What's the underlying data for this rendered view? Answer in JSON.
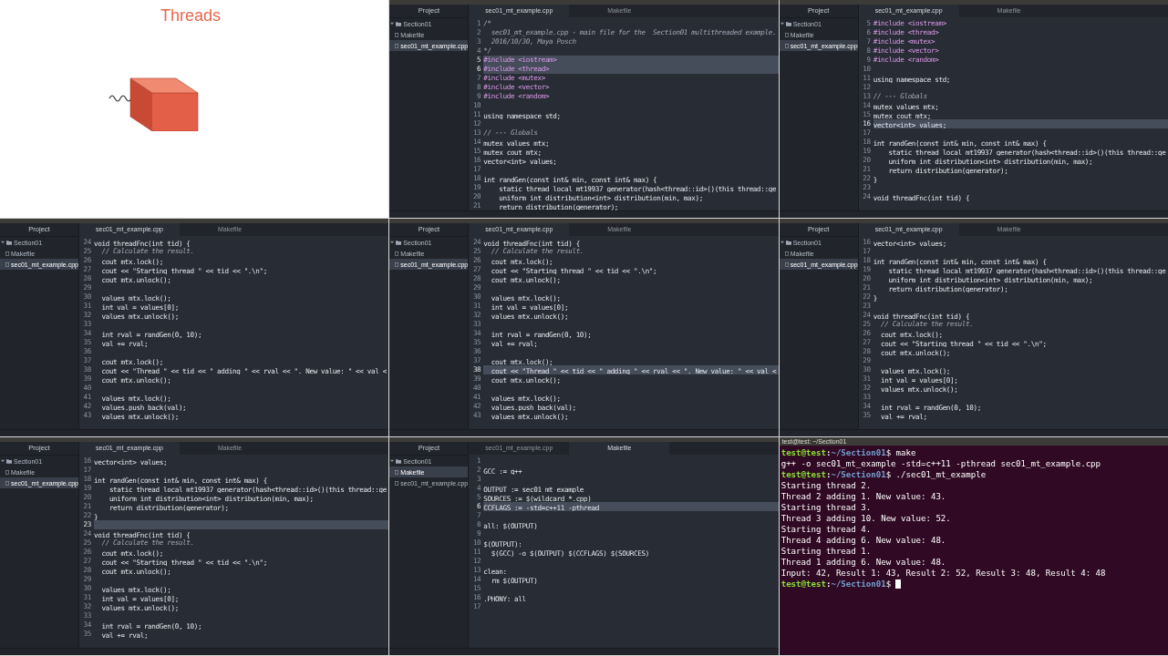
{
  "tiles": [
    {
      "kind": "slide",
      "title": "Threads"
    },
    {
      "kind": "editor",
      "project_title": "Project",
      "tree": [
        {
          "label": "Section01",
          "expanded": true,
          "selected": false,
          "children": [
            {
              "label": "Makefile",
              "selected": false
            },
            {
              "label": "sec01_mt_example.cpp",
              "selected": true
            }
          ]
        }
      ],
      "tabs": [
        {
          "label": "sec01_mt_example.cpp",
          "selected": true
        },
        {
          "label": "Makefile",
          "selected": false
        }
      ],
      "lines": [
        {
          "n": "1",
          "code": "/*",
          "kind": "comment",
          "highlighted": false
        },
        {
          "n": "2",
          "code": "  sec01_mt_example.cpp - main file for the  Section01 multithreaded example.",
          "kind": "comment",
          "highlighted": false
        },
        {
          "n": "3",
          "code": "  2016/10/30, Maya Posch",
          "kind": "comment",
          "highlighted": false
        },
        {
          "n": "4",
          "code": "*/",
          "kind": "comment",
          "highlighted": false
        },
        {
          "n": "5",
          "code": "#include <iostream>",
          "kind": "directive",
          "highlighted": true
        },
        {
          "n": "6",
          "code": "#include <thread>",
          "kind": "directive",
          "highlighted": true
        },
        {
          "n": "7",
          "code": "#include <mutex>",
          "kind": "directive",
          "highlighted": false
        },
        {
          "n": "8",
          "code": "#include <vector>",
          "kind": "directive",
          "highlighted": false
        },
        {
          "n": "9",
          "code": "#include <random>",
          "kind": "directive",
          "highlighted": false
        },
        {
          "n": "10",
          "kind": "code",
          "highlighted": false
        },
        {
          "n": "11",
          "code": "using namespace std;",
          "kind": "code",
          "highlighted": false
        },
        {
          "n": "12",
          "kind": "code",
          "highlighted": false
        },
        {
          "n": "13",
          "code": "// --- Globals",
          "kind": "comment",
          "highlighted": false
        },
        {
          "n": "14",
          "code": "mutex values_mtx;",
          "kind": "code",
          "highlighted": false
        },
        {
          "n": "15",
          "code": "mutex cout_mtx;",
          "kind": "code",
          "highlighted": false
        },
        {
          "n": "16",
          "code": "vector<int> values;",
          "kind": "code",
          "highlighted": false
        },
        {
          "n": "17",
          "kind": "code",
          "highlighted": false
        },
        {
          "n": "18",
          "code": "int randGen(const int& min, const int& max) {",
          "kind": "code",
          "highlighted": false
        },
        {
          "n": "19",
          "code": "    static thread_local mt19937 generator(hash<thread::id>()(this_thread::ge",
          "kind": "code",
          "highlighted": false
        },
        {
          "n": "20",
          "code": "    uniform_int_distribution<int> distribution(min, max);",
          "kind": "code",
          "highlighted": false
        },
        {
          "n": "21",
          "code": "    return distribution(generator);",
          "kind": "code",
          "highlighted": false
        }
      ]
    },
    {
      "kind": "editor",
      "project_title": "Project",
      "tree": [
        {
          "label": "Section01",
          "expanded": true,
          "selected": false,
          "children": [
            {
              "label": "Makefile",
              "selected": false
            },
            {
              "label": "sec01_mt_example.cpp",
              "selected": true
            }
          ]
        }
      ],
      "tabs": [
        {
          "label": "sec01_mt_example.cpp",
          "selected": true
        },
        {
          "label": "Makefile",
          "selected": false
        }
      ],
      "lines": [
        {
          "n": "5",
          "code": "#include <iostream>",
          "kind": "directive",
          "highlighted": false
        },
        {
          "n": "6",
          "code": "#include <thread>",
          "kind": "directive",
          "highlighted": false
        },
        {
          "n": "7",
          "code": "#include <mutex>",
          "kind": "directive",
          "highlighted": false
        },
        {
          "n": "8",
          "code": "#include <vector>",
          "kind": "directive",
          "highlighted": false
        },
        {
          "n": "9",
          "code": "#include <random>",
          "kind": "directive",
          "highlighted": false
        },
        {
          "n": "10",
          "kind": "code",
          "highlighted": false
        },
        {
          "n": "11",
          "code": "using namespace std;",
          "kind": "code",
          "highlighted": false
        },
        {
          "n": "12",
          "kind": "code",
          "highlighted": false
        },
        {
          "n": "13",
          "code": "// --- Globals",
          "kind": "comment",
          "highlighted": false
        },
        {
          "n": "14",
          "code": "mutex values_mtx;",
          "kind": "code",
          "highlighted": false
        },
        {
          "n": "15",
          "code": "mutex cout_mtx;",
          "kind": "code",
          "highlighted": false
        },
        {
          "n": "16",
          "code": "vector<int> values;",
          "kind": "code",
          "highlighted": true
        },
        {
          "n": "17",
          "kind": "code",
          "highlighted": false
        },
        {
          "n": "18",
          "code": "int randGen(const int& min, const int& max) {",
          "kind": "code",
          "highlighted": false
        },
        {
          "n": "19",
          "code": "    static thread_local mt19937 generator(hash<thread::id>()(this_thread::ge",
          "kind": "code",
          "highlighted": false
        },
        {
          "n": "20",
          "code": "    uniform_int_distribution<int> distribution(min, max);",
          "kind": "code",
          "highlighted": false
        },
        {
          "n": "21",
          "code": "    return distribution(generator);",
          "kind": "code",
          "highlighted": false
        },
        {
          "n": "22",
          "code": "}",
          "kind": "code",
          "highlighted": false
        },
        {
          "n": "23",
          "kind": "code",
          "highlighted": false
        },
        {
          "n": "24",
          "code": "void threadFnc(int tid) {",
          "kind": "code",
          "highlighted": false
        }
      ]
    },
    {
      "kind": "editor",
      "project_title": "Project",
      "tree": [
        {
          "label": "Section01",
          "expanded": true,
          "selected": false,
          "children": [
            {
              "label": "Makefile",
              "selected": false
            },
            {
              "label": "sec01_mt_example.cpp",
              "selected": true
            }
          ]
        }
      ],
      "tabs": [
        {
          "label": "sec01_mt_example.cpp",
          "selected": true
        },
        {
          "label": "Makefile",
          "selected": false
        }
      ],
      "lines": [
        {
          "n": "24",
          "code": "void threadFnc(int tid) {",
          "kind": "code",
          "highlighted": false
        },
        {
          "n": "25",
          "code": "  // Calculate the result.",
          "kind": "comment",
          "highlighted": false
        },
        {
          "n": "26",
          "code": "  cout_mtx.lock();",
          "kind": "code",
          "highlighted": false
        },
        {
          "n": "27",
          "code": "  cout << \"Starting thread \" << tid << \".\\n\";",
          "kind": "code",
          "highlighted": false
        },
        {
          "n": "28",
          "code": "  cout_mtx.unlock();",
          "kind": "code",
          "highlighted": false
        },
        {
          "n": "29",
          "kind": "code",
          "highlighted": false
        },
        {
          "n": "30",
          "code": "  values_mtx.lock();",
          "kind": "code",
          "highlighted": false
        },
        {
          "n": "31",
          "code": "  int val = values[0];",
          "kind": "code",
          "highlighted": false
        },
        {
          "n": "32",
          "code": "  values_mtx.unlock();",
          "kind": "code",
          "highlighted": false
        },
        {
          "n": "33",
          "kind": "code",
          "highlighted": false
        },
        {
          "n": "34",
          "code": "  int rval = randGen(0, 10);",
          "kind": "code",
          "highlighted": false
        },
        {
          "n": "35",
          "code": "  val += rval;",
          "kind": "code",
          "highlighted": false
        },
        {
          "n": "36",
          "kind": "code",
          "highlighted": false
        },
        {
          "n": "37",
          "code": "  cout_mtx.lock();",
          "kind": "code",
          "highlighted": false
        },
        {
          "n": "38",
          "code": "  cout << \"Thread \" << tid << \" adding \" << rval << \". New value: \" << val <",
          "kind": "code",
          "highlighted": false
        },
        {
          "n": "39",
          "code": "  cout_mtx.unlock();",
          "kind": "code",
          "highlighted": false
        },
        {
          "n": "40",
          "kind": "code",
          "highlighted": false
        },
        {
          "n": "41",
          "code": "  values_mtx.lock();",
          "kind": "code",
          "highlighted": false
        },
        {
          "n": "42",
          "code": "  values.push_back(val);",
          "kind": "code",
          "highlighted": false
        },
        {
          "n": "43",
          "code": "  values_mtx.unlock();",
          "kind": "code",
          "highlighted": false
        }
      ]
    },
    {
      "kind": "editor",
      "project_title": "Project",
      "tree": [
        {
          "label": "Section01",
          "expanded": true,
          "selected": false,
          "children": [
            {
              "label": "Makefile",
              "selected": false
            },
            {
              "label": "sec01_mt_example.cpp",
              "selected": true
            }
          ]
        }
      ],
      "tabs": [
        {
          "label": "sec01_mt_example.cpp",
          "selected": true
        },
        {
          "label": "Makefile",
          "selected": false
        }
      ],
      "lines": [
        {
          "n": "24",
          "code": "void threadFnc(int tid) {",
          "kind": "code",
          "highlighted": false
        },
        {
          "n": "25",
          "code": "  // Calculate the result.",
          "kind": "comment",
          "highlighted": false
        },
        {
          "n": "26",
          "code": "  cout_mtx.lock();",
          "kind": "code",
          "highlighted": false
        },
        {
          "n": "27",
          "code": "  cout << \"Starting thread \" << tid << \".\\n\";",
          "kind": "code",
          "highlighted": false
        },
        {
          "n": "28",
          "code": "  cout_mtx.unlock();",
          "kind": "code",
          "highlighted": false
        },
        {
          "n": "29",
          "kind": "code",
          "highlighted": false
        },
        {
          "n": "30",
          "code": "  values_mtx.lock();",
          "kind": "code",
          "highlighted": false
        },
        {
          "n": "31",
          "code": "  int val = values[0];",
          "kind": "code",
          "highlighted": false
        },
        {
          "n": "32",
          "code": "  values_mtx.unlock();",
          "kind": "code",
          "highlighted": false
        },
        {
          "n": "33",
          "kind": "code",
          "highlighted": false
        },
        {
          "n": "34",
          "code": "  int rval = randGen(0, 10);",
          "kind": "code",
          "highlighted": false
        },
        {
          "n": "35",
          "code": "  val += rval;",
          "kind": "code",
          "highlighted": false
        },
        {
          "n": "36",
          "kind": "code",
          "highlighted": false
        },
        {
          "n": "37",
          "code": "  cout_mtx.lock();",
          "kind": "code",
          "highlighted": false
        },
        {
          "n": "38",
          "code": "  cout << \"Thread \" << tid << \" adding \" << rval << \". New value: \" << val <",
          "kind": "code",
          "highlighted": true
        },
        {
          "n": "39",
          "code": "  cout_mtx.unlock();",
          "kind": "code",
          "highlighted": false
        },
        {
          "n": "40",
          "kind": "code",
          "highlighted": false
        },
        {
          "n": "41",
          "code": "  values_mtx.lock();",
          "kind": "code",
          "highlighted": false
        },
        {
          "n": "42",
          "code": "  values.push_back(val);",
          "kind": "code",
          "highlighted": false
        },
        {
          "n": "43",
          "code": "  values_mtx.unlock();",
          "kind": "code",
          "highlighted": false
        }
      ]
    },
    {
      "kind": "editor",
      "project_title": "Project",
      "tree": [
        {
          "label": "Section01",
          "expanded": true,
          "selected": false,
          "children": [
            {
              "label": "Makefile",
              "selected": false
            },
            {
              "label": "sec01_mt_example.cpp",
              "selected": true
            }
          ]
        }
      ],
      "tabs": [
        {
          "label": "sec01_mt_example.cpp",
          "selected": true
        },
        {
          "label": "Makefile",
          "selected": false
        }
      ],
      "lines": [
        {
          "n": "16",
          "code": "vector<int> values;",
          "kind": "code",
          "highlighted": false
        },
        {
          "n": "17",
          "kind": "code",
          "highlighted": false
        },
        {
          "n": "18",
          "code": "int randGen(const int& min, const int& max) {",
          "kind": "code",
          "highlighted": false
        },
        {
          "n": "19",
          "code": "    static thread_local mt19937 generator(hash<thread::id>()(this_thread::ge",
          "kind": "code",
          "highlighted": false
        },
        {
          "n": "20",
          "code": "    uniform_int_distribution<int> distribution(min, max);",
          "kind": "code",
          "highlighted": false
        },
        {
          "n": "21",
          "code": "    return distribution(generator);",
          "kind": "code",
          "highlighted": false
        },
        {
          "n": "22",
          "code": "}",
          "kind": "code",
          "highlighted": false
        },
        {
          "n": "23",
          "kind": "code",
          "highlighted": false
        },
        {
          "n": "24",
          "code": "void threadFnc(int tid) {",
          "kind": "code",
          "highlighted": false
        },
        {
          "n": "25",
          "code": "  // Calculate the result.",
          "kind": "comment",
          "highlighted": false
        },
        {
          "n": "26",
          "code": "  cout_mtx.lock();",
          "kind": "code",
          "highlighted": false
        },
        {
          "n": "27",
          "code": "  cout << \"Starting thread \" << tid << \".\\n\";",
          "kind": "code",
          "highlighted": false
        },
        {
          "n": "28",
          "code": "  cout_mtx.unlock();",
          "kind": "code",
          "highlighted": false
        },
        {
          "n": "29",
          "kind": "code",
          "highlighted": false
        },
        {
          "n": "30",
          "code": "  values_mtx.lock();",
          "kind": "code",
          "highlighted": false
        },
        {
          "n": "31",
          "code": "  int val = values[0];",
          "kind": "code",
          "highlighted": false
        },
        {
          "n": "32",
          "code": "  values_mtx.unlock();",
          "kind": "code",
          "highlighted": false
        },
        {
          "n": "33",
          "kind": "code",
          "highlighted": false
        },
        {
          "n": "34",
          "code": "  int rval = randGen(0, 10);",
          "kind": "code",
          "highlighted": false
        },
        {
          "n": "35",
          "code": "  val += rval;",
          "kind": "code",
          "highlighted": false
        }
      ]
    },
    {
      "kind": "editor",
      "project_title": "Project",
      "tree": [
        {
          "label": "Section01",
          "expanded": true,
          "selected": false,
          "children": [
            {
              "label": "Makefile",
              "selected": false
            },
            {
              "label": "sec01_mt_example.cpp",
              "selected": true
            }
          ]
        }
      ],
      "tabs": [
        {
          "label": "sec01_mt_example.cpp",
          "selected": true
        },
        {
          "label": "Makefile",
          "selected": false
        }
      ],
      "lines": [
        {
          "n": "16",
          "code": "vector<int> values;",
          "kind": "code",
          "highlighted": false
        },
        {
          "n": "17",
          "kind": "code",
          "highlighted": false
        },
        {
          "n": "18",
          "code": "int randGen(const int& min, const int& max) {",
          "kind": "code",
          "highlighted": false
        },
        {
          "n": "19",
          "code": "    static thread_local mt19937 generator(hash<thread::id>()(this_thread::ge",
          "kind": "code",
          "highlighted": false
        },
        {
          "n": "20",
          "code": "    uniform_int_distribution<int> distribution(min, max);",
          "kind": "code",
          "highlighted": false
        },
        {
          "n": "21",
          "code": "    return distribution(generator);",
          "kind": "code",
          "highlighted": false
        },
        {
          "n": "22",
          "code": "}",
          "kind": "code",
          "highlighted": false
        },
        {
          "n": "23",
          "kind": "code",
          "highlighted": true
        },
        {
          "n": "24",
          "code": "void threadFnc(int tid) {",
          "kind": "code",
          "highlighted": false
        },
        {
          "n": "25",
          "code": "  // Calculate the result.",
          "kind": "comment",
          "highlighted": false
        },
        {
          "n": "26",
          "code": "  cout_mtx.lock();",
          "kind": "code",
          "highlighted": false
        },
        {
          "n": "27",
          "code": "  cout << \"Starting thread \" << tid << \".\\n\";",
          "kind": "code",
          "highlighted": false
        },
        {
          "n": "28",
          "code": "  cout_mtx.unlock();",
          "kind": "code",
          "highlighted": false
        },
        {
          "n": "29",
          "kind": "code",
          "highlighted": false
        },
        {
          "n": "30",
          "code": "  values_mtx.lock();",
          "kind": "code",
          "highlighted": false
        },
        {
          "n": "31",
          "code": "  int val = values[0];",
          "kind": "code",
          "highlighted": false
        },
        {
          "n": "32",
          "code": "  values_mtx.unlock();",
          "kind": "code",
          "highlighted": false
        },
        {
          "n": "33",
          "kind": "code",
          "highlighted": false
        },
        {
          "n": "34",
          "code": "  int rval = randGen(0, 10);",
          "kind": "code",
          "highlighted": false
        },
        {
          "n": "35",
          "code": "  val += rval;",
          "kind": "code",
          "highlighted": false
        }
      ]
    },
    {
      "kind": "editor",
      "project_title": "Project",
      "tree": [
        {
          "label": "Section01",
          "expanded": true,
          "selected": false,
          "children": [
            {
              "label": "Makefile",
              "selected": true
            },
            {
              "label": "sec01_mt_example.cpp",
              "selected": false
            }
          ]
        }
      ],
      "tabs": [
        {
          "label": "sec01_mt_example.cpp",
          "selected": false
        },
        {
          "label": "Makefile",
          "selected": true
        }
      ],
      "lines": [
        {
          "n": "1",
          "kind": "code",
          "highlighted": false
        },
        {
          "n": "2",
          "code": "GCC := g++",
          "kind": "code",
          "highlighted": false
        },
        {
          "n": "3",
          "kind": "code",
          "highlighted": false
        },
        {
          "n": "4",
          "code": "OUTPUT := sec01_mt_example",
          "kind": "code",
          "highlighted": false
        },
        {
          "n": "5",
          "code": "SOURCES := $(wildcard *.cpp)",
          "kind": "code",
          "highlighted": false
        },
        {
          "n": "6",
          "code": "CCFLAGS := -std=c++11 -pthread",
          "kind": "code",
          "highlighted": true
        },
        {
          "n": "7",
          "kind": "code",
          "highlighted": false
        },
        {
          "n": "8",
          "code": "all: $(OUTPUT)",
          "kind": "code",
          "highlighted": false
        },
        {
          "n": "9",
          "kind": "code",
          "highlighted": false
        },
        {
          "n": "10",
          "code": "$(OUTPUT):",
          "kind": "code",
          "highlighted": false
        },
        {
          "n": "11",
          "code": "  $(GCC) -o $(OUTPUT) $(CCFLAGS) $(SOURCES)",
          "kind": "code",
          "highlighted": false
        },
        {
          "n": "12",
          "kind": "code",
          "highlighted": false
        },
        {
          "n": "13",
          "code": "clean:",
          "kind": "code",
          "highlighted": false
        },
        {
          "n": "14",
          "code": "  rm $(OUTPUT)",
          "kind": "code",
          "highlighted": false
        },
        {
          "n": "15",
          "kind": "code",
          "highlighted": false
        },
        {
          "n": "16",
          "code": ".PHONY: all",
          "kind": "code",
          "highlighted": false
        },
        {
          "n": "17",
          "kind": "code",
          "highlighted": false
        }
      ]
    },
    {
      "kind": "terminal",
      "title": "test@test: ~/Section01",
      "lines": [
        {
          "kind": "prompt",
          "user": "test@test",
          "sep": ":",
          "path": "~/Section01",
          "command": "$ make"
        },
        {
          "kind": "output",
          "text": "g++ -o sec01_mt_example -std=c++11 -pthread sec01_mt_example.cpp"
        },
        {
          "kind": "prompt",
          "user": "test@test",
          "sep": ":",
          "path": "~/Section01",
          "command": "$ ./sec01_mt_example"
        },
        {
          "kind": "output",
          "text": "Starting thread 2."
        },
        {
          "kind": "output",
          "text": "Thread 2 adding 1. New value: 43."
        },
        {
          "kind": "output",
          "text": "Starting thread 3."
        },
        {
          "kind": "output",
          "text": "Thread 3 adding 10. New value: 52."
        },
        {
          "kind": "output",
          "text": "Starting thread 4."
        },
        {
          "kind": "output",
          "text": "Thread 4 adding 6. New value: 48."
        },
        {
          "kind": "output",
          "text": "Starting thread 1."
        },
        {
          "kind": "output",
          "text": "Thread 1 adding 6. New value: 48."
        },
        {
          "kind": "output",
          "text": "Input: 42, Result 1: 43, Result 2: 52, Result 3: 48, Result 4: 48"
        },
        {
          "kind": "prompt",
          "user": "test@test",
          "sep": ":",
          "path": "~/Section01",
          "command": "$",
          "cursor": true
        }
      ]
    }
  ]
}
